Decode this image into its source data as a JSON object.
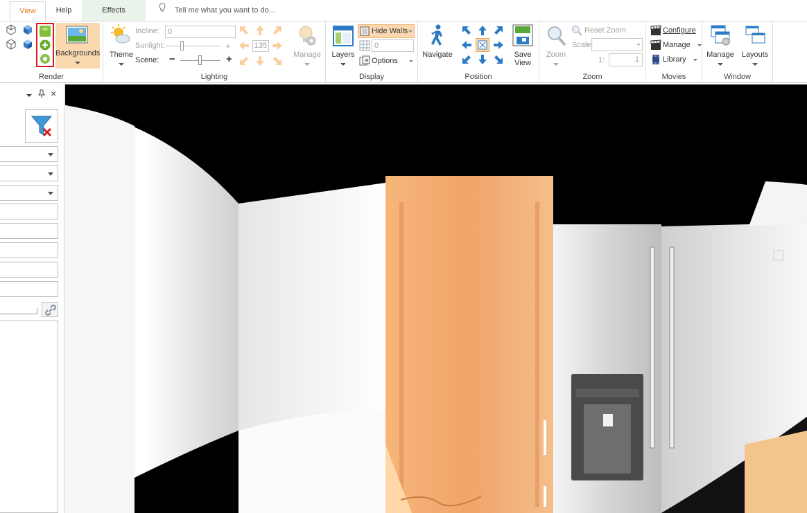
{
  "tabs": [
    {
      "label": "View"
    },
    {
      "label": "Help"
    },
    {
      "label": "Effects"
    }
  ],
  "tell_me": "Tell me what you want to do...",
  "ribbon": {
    "render": {
      "label": "Render",
      "backgrounds": "Backgrounds"
    },
    "lighting": {
      "label": "Lighting",
      "theme": "Theme",
      "incline_label": "Incline:",
      "incline_value": "0",
      "sunlight_label": "Sunlight:",
      "sunlight_value": "135",
      "scene_label": "Scene:",
      "minus": "−",
      "plus": "+",
      "manage": "Manage"
    },
    "display": {
      "label": "Display",
      "layers": "Layers",
      "hide_walls": "Hide Walls",
      "grid_value": "0",
      "options": "Options"
    },
    "position": {
      "label": "Position",
      "navigate": "Navigate",
      "save_view_1": "Save",
      "save_view_2": "View"
    },
    "zoom": {
      "label": "Zoom",
      "zoom": "Zoom",
      "reset_zoom": "Reset Zoom",
      "scale_label": "Scale:",
      "ratio_label": "1:",
      "ratio_value": "1"
    },
    "movies": {
      "label": "Movies",
      "configure": "Configure",
      "manage": "Manage",
      "library": "Library"
    },
    "window": {
      "label": "Window",
      "manage": "Manage",
      "layouts": "Layouts"
    }
  },
  "panel": {
    "pin": "↕",
    "close": "×"
  },
  "colors": {
    "accent": "#e07b20",
    "effects_tab_bg": "#eaf3e9",
    "highlight_bg": "#fbd9b0",
    "selection_outline": "#d9191c"
  }
}
